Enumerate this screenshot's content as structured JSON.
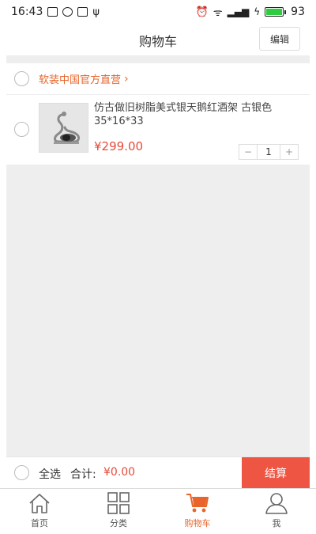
{
  "status_bar": {
    "time": "16:43",
    "battery": "93",
    "signal_text": "₴ıl"
  },
  "header": {
    "title": "购物车",
    "edit_label": "编辑"
  },
  "shop": {
    "name": "软装中国官方直营",
    "chevron": "›"
  },
  "item": {
    "title": "仿古做旧树脂美式银天鹅红酒架 古银色 35*16*33",
    "price": "¥299.00",
    "quantity": "1",
    "minus": "−",
    "plus": "+"
  },
  "checkout": {
    "select_all_label": "全选",
    "total_label": "合计:",
    "total_value": "¥0.00",
    "settle_label": "结算"
  },
  "tabbar": {
    "items": [
      {
        "label": "首页",
        "icon": "home-icon"
      },
      {
        "label": "分类",
        "icon": "category-icon"
      },
      {
        "label": "购物车",
        "icon": "cart-icon"
      },
      {
        "label": "我",
        "icon": "user-icon"
      }
    ],
    "active_index": 2,
    "active_color": "#e8642b"
  },
  "colors": {
    "accent": "#e8642b",
    "price": "#e84a3a",
    "settle_button": "#ef5543"
  }
}
